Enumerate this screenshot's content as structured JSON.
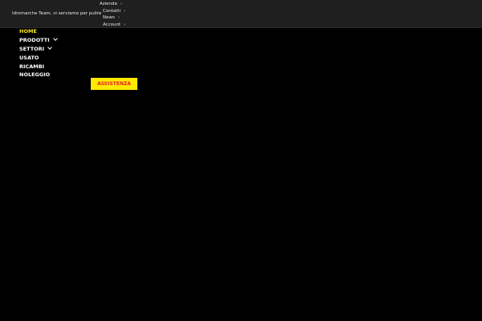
{
  "topbar": {
    "tagline": "Idromarche Team, vi serviamo per pulire",
    "links": [
      {
        "label": "Azienda",
        "chevron": "›"
      },
      {
        "label": "Contatti",
        "chevron": "›"
      },
      {
        "label": "News",
        "chevron": "›"
      },
      {
        "label": "Account",
        "chevron": "›"
      }
    ]
  },
  "nav": {
    "items": [
      {
        "label": "HOME",
        "active": true,
        "has_dropdown": false
      },
      {
        "label": "PRODOTTI",
        "active": false,
        "has_dropdown": true
      },
      {
        "label": "SETTORI",
        "active": false,
        "has_dropdown": true
      },
      {
        "label": "USATO",
        "active": false,
        "has_dropdown": false
      },
      {
        "label": "RICAMBI",
        "active": false,
        "has_dropdown": false
      },
      {
        "label": "NOLEGGIO",
        "active": false,
        "has_dropdown": false
      }
    ]
  },
  "cta": {
    "label": "ASSISTENZA"
  },
  "colors": {
    "background": "#000000",
    "topbar": "#1f1f1f",
    "accent_yellow": "#ffea00",
    "cta_text_red": "#e0202a",
    "active_nav": "#f5e616"
  },
  "icons": {
    "top_link_chevron": "chevron-right-icon",
    "nav_dropdown_chevron": "chevron-down-icon"
  }
}
